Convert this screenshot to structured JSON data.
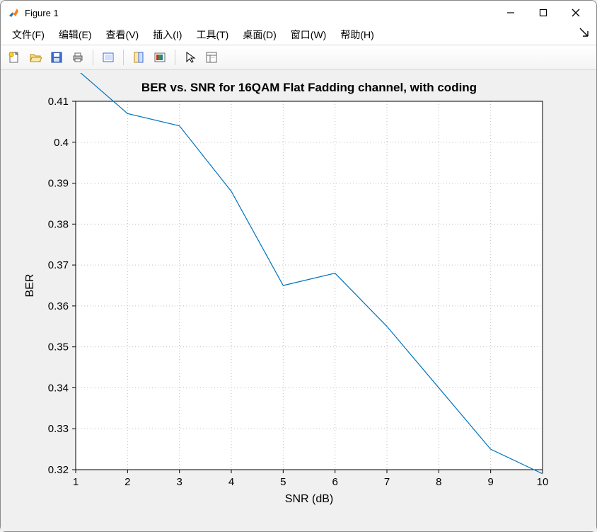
{
  "window": {
    "title": "Figure 1"
  },
  "menu": {
    "file": "文件(F)",
    "edit": "编辑(E)",
    "view": "查看(V)",
    "insert": "插入(I)",
    "tools": "工具(T)",
    "desktop": "桌面(D)",
    "window": "窗口(W)",
    "help": "帮助(H)"
  },
  "toolbar": {
    "new": "new-figure",
    "open": "open",
    "save": "save",
    "print": "print",
    "edit_plot": "edit-plot",
    "data_cursor": "data-cursor",
    "legend": "legend",
    "pointer": "pointer",
    "colorbar": "colorbar"
  },
  "chart_data": {
    "type": "line",
    "title": "BER vs. SNR for 16QAM Flat Fadding channel, with coding",
    "xlabel": "SNR (dB)",
    "ylabel": "BER",
    "x": [
      1,
      2,
      3,
      4,
      5,
      6,
      7,
      8,
      9,
      10
    ],
    "y": [
      0.418,
      0.407,
      0.404,
      0.388,
      0.365,
      0.368,
      0.355,
      0.34,
      0.325,
      0.319
    ],
    "xlim": [
      1,
      10
    ],
    "ylim": [
      0.32,
      0.41
    ],
    "xticks": [
      1,
      2,
      3,
      4,
      5,
      6,
      7,
      8,
      9,
      10
    ],
    "yticks": [
      0.32,
      0.33,
      0.34,
      0.35,
      0.36,
      0.37,
      0.38,
      0.39,
      0.4,
      0.41
    ],
    "grid": true,
    "line_color": "#0072BD"
  }
}
